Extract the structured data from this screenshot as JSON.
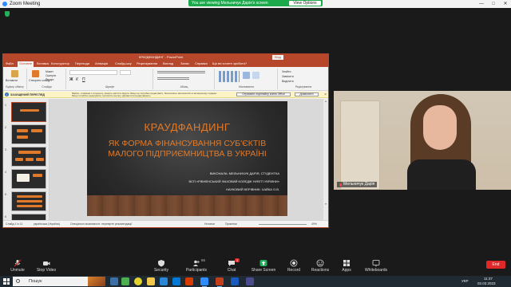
{
  "zoom": {
    "title": "Zoom Meeting",
    "share_banner": "You are viewing Мельничук Дарія's screen",
    "view_options": "View Options",
    "window_controls": [
      "—",
      "□",
      "✕"
    ]
  },
  "ppt": {
    "title": "КРАУДФАНДИНГ - PowerPoint",
    "sign_in": "Вхід",
    "tabs": [
      "Файл",
      "Основне",
      "Вставка",
      "Конструктор",
      "Переходи",
      "Анімація",
      "Слайд-шоу",
      "Рецензування",
      "Вигляд",
      "Запис",
      "Справка",
      "Що ви хочете зробити?"
    ],
    "ribbon": {
      "groups": [
        "Буфер обміну",
        "Слайди",
        "Шрифт",
        "Абзац",
        "Малювання",
        "Редагування"
      ],
      "paste": "Вставити",
      "new_slide": "Створити слайд",
      "layout": "Макет",
      "reset": "Скинути",
      "section": "Розділ",
      "find": "Знайти",
      "replace": "Замінити",
      "select": "Виділити"
    },
    "warning": {
      "heading": "ЗАХИЩЕНИЙ ПЕРЕГЛЯД",
      "line1": "Файли, отримані з Інтернету, можуть містити віруси. Якщо не потрібно редагувати, безпечніше залишатися в захищеному поданні.",
      "line2": "Якщо потрібно редагувати, натисніть кнопку «Дозволити редагування».",
      "button_activate": "Отримати ліцензійну копію Office",
      "button_enable": "Дозволити"
    },
    "slide": {
      "title": "КРАУДФАНДИНГ",
      "subtitle1": "ЯК ФОРМА ФІНАНСУВАННЯ СУБ'ЄКТІВ",
      "subtitle2": "МАЛОГО ПІДПРИЄМНИЦТВА В УКРАЇНІ",
      "author": "ВИКОНАЛА: МЕЛЬНИЧУК ДАРІЯ, СТУДЕНТКА",
      "college": "ВСП «РІВНЕНСЬКИЙ ФАХОВИЙ КОЛЕДЖ НУВГП УКРАЇНИ»",
      "supervisor": "НАУКОВИЙ КЕРІВНИК: ЧАЙКА О.В."
    },
    "thumb_numbers": [
      "1",
      "2",
      "3",
      "4",
      "5",
      "6"
    ],
    "status": {
      "slide_of": "Слайд 1 із 11",
      "language": "українська (Україна)",
      "accessibility": "Спеціальні можливості: перевірте рекомендації",
      "notes": "Нотатки",
      "comments": "Примітки",
      "zoom": "49%"
    }
  },
  "participant": {
    "name": "Мельничук Дарія"
  },
  "toolbar": {
    "unmute": "Unmute",
    "stop_video": "Stop Video",
    "security": "Security",
    "participants": "Participants",
    "participants_count": "86",
    "chat": "Chat",
    "chat_badge": "3",
    "share_screen": "Share Screen",
    "record": "Record",
    "reactions": "Reactions",
    "apps": "Apps",
    "whiteboards": "Whiteboards",
    "end": "End"
  },
  "taskbar": {
    "search": "Пошук",
    "lang": "УКР",
    "time": "11:37",
    "date": "02.03.2023"
  },
  "colors": {
    "ppt_brand": "#b7472a",
    "slide_accent": "#e07a2a",
    "zoom_green": "#1ba94c",
    "end_red": "#e02828"
  }
}
